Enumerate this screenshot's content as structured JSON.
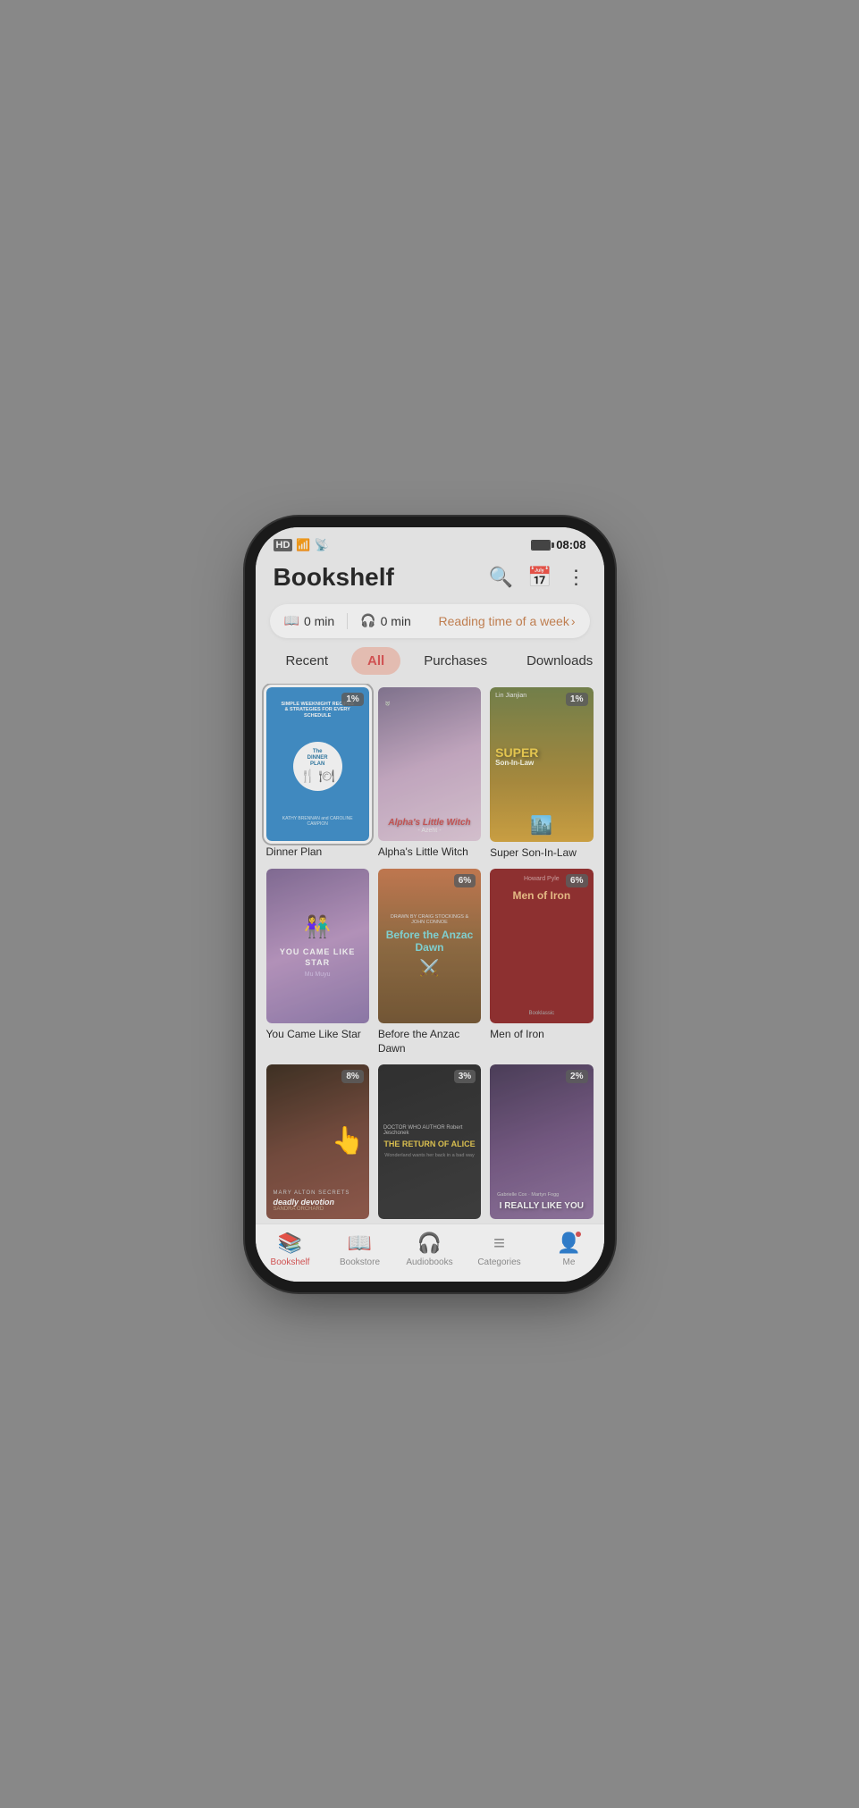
{
  "statusBar": {
    "left": "HD",
    "signal": "5G",
    "wifi": "WiFi",
    "battery": "100",
    "time": "08:08"
  },
  "header": {
    "title": "Bookshelf",
    "searchLabel": "Search",
    "calendarLabel": "Calendar",
    "moreLabel": "More options"
  },
  "readingBar": {
    "bookIcon": "📖",
    "bookTime": "0 min",
    "headphonesIcon": "🎧",
    "audioTime": "0 min",
    "linkText": "Reading time of a week",
    "chevron": "›"
  },
  "filters": [
    {
      "id": "recent",
      "label": "Recent",
      "active": false
    },
    {
      "id": "all",
      "label": "All",
      "active": true
    },
    {
      "id": "purchases",
      "label": "Purchases",
      "active": false
    },
    {
      "id": "downloads",
      "label": "Downloads",
      "active": false
    }
  ],
  "books": [
    {
      "id": "dinner-plan",
      "title": "Dinner Plan",
      "badge": "1%",
      "selected": true,
      "coverType": "dinner"
    },
    {
      "id": "alphas-little-witch",
      "title": "Alpha's Little Witch",
      "badge": null,
      "selected": false,
      "coverType": "alpha"
    },
    {
      "id": "super-son-in-law",
      "title": "Super Son-In-Law",
      "badge": "1%",
      "selected": false,
      "coverType": "super"
    },
    {
      "id": "you-came-like-star",
      "title": "You Came Like Star",
      "badge": null,
      "selected": false,
      "coverType": "star"
    },
    {
      "id": "before-anzac-dawn",
      "title": "Before the Anzac Dawn",
      "badge": "6%",
      "selected": false,
      "coverType": "anzac"
    },
    {
      "id": "men-of-iron",
      "title": "Men of Iron",
      "badge": "6%",
      "selected": false,
      "coverType": "iron"
    },
    {
      "id": "deadly-devotion",
      "title": "Deadly Devotion",
      "badge": "8%",
      "selected": false,
      "coverType": "deadly"
    },
    {
      "id": "return-of-alice",
      "title": "The Return of Alice",
      "badge": "3%",
      "selected": false,
      "coverType": "alice"
    },
    {
      "id": "i-really-like-you",
      "title": "I Really Like You",
      "badge": "2%",
      "selected": false,
      "coverType": "like"
    }
  ],
  "bottomNav": [
    {
      "id": "bookshelf",
      "label": "Bookshelf",
      "icon": "📚",
      "active": true,
      "dot": false
    },
    {
      "id": "bookstore",
      "label": "Bookstore",
      "icon": "📖",
      "active": false,
      "dot": false
    },
    {
      "id": "audiobooks",
      "label": "Audiobooks",
      "icon": "🎧",
      "active": false,
      "dot": false
    },
    {
      "id": "categories",
      "label": "Categories",
      "icon": "☰",
      "active": false,
      "dot": false
    },
    {
      "id": "me",
      "label": "Me",
      "icon": "👤",
      "active": false,
      "dot": true
    }
  ]
}
